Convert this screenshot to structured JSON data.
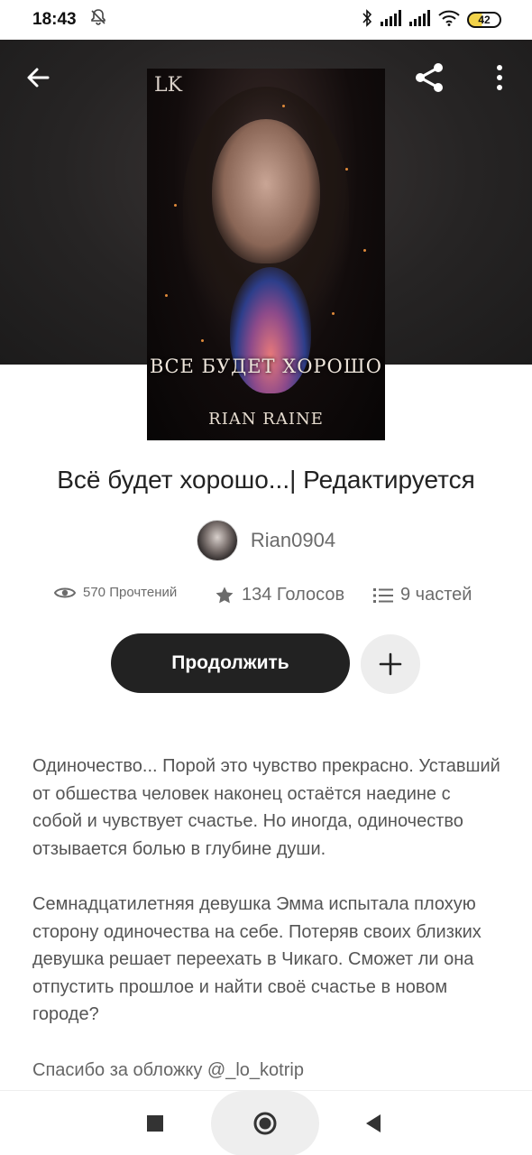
{
  "status_bar": {
    "time": "18:43",
    "battery": "42",
    "icons": [
      "mute-bell-icon",
      "bluetooth-icon",
      "signal-icon",
      "signal-icon",
      "wifi-icon",
      "battery-icon"
    ]
  },
  "header": {
    "back_icon": "arrow-left-icon",
    "share_icon": "share-icon",
    "more_icon": "more-vertical-icon"
  },
  "cover": {
    "monogram": "LK",
    "title_art": "ВСЕ БУДЕТ ХОРОШО",
    "author_art": "RIAN RAINE"
  },
  "story": {
    "title": "Всё будет хорошо...| Редактируется",
    "author": "Rian0904",
    "stats": {
      "reads": "570 Прочтений",
      "votes": "134 Голосов",
      "parts": "9 частей"
    }
  },
  "actions": {
    "continue_label": "Продолжить",
    "add_icon": "plus-icon"
  },
  "description": {
    "paragraph_1": "Одиночество... Порой это чувство прекрасно. Уставший от обшества человек наконец остаётся наедине с собой и чувствует счастье. Но иногда, одиночество отзывается болью в глубине души.",
    "paragraph_2": "Семнадцатилетняя девушка Эмма испытала плохую сторону одиночества на себе. Потеряв своих близких девушка решает переехать в Чикаго. Сможет ли она отпустить прошлое и найти своё счастье в новом городе?",
    "paragraph_3": "Спасибо за обложку @_lo_kotrip"
  },
  "nav_bar": {
    "icons": [
      "square-icon",
      "home-circle-icon",
      "back-triangle-icon"
    ]
  }
}
